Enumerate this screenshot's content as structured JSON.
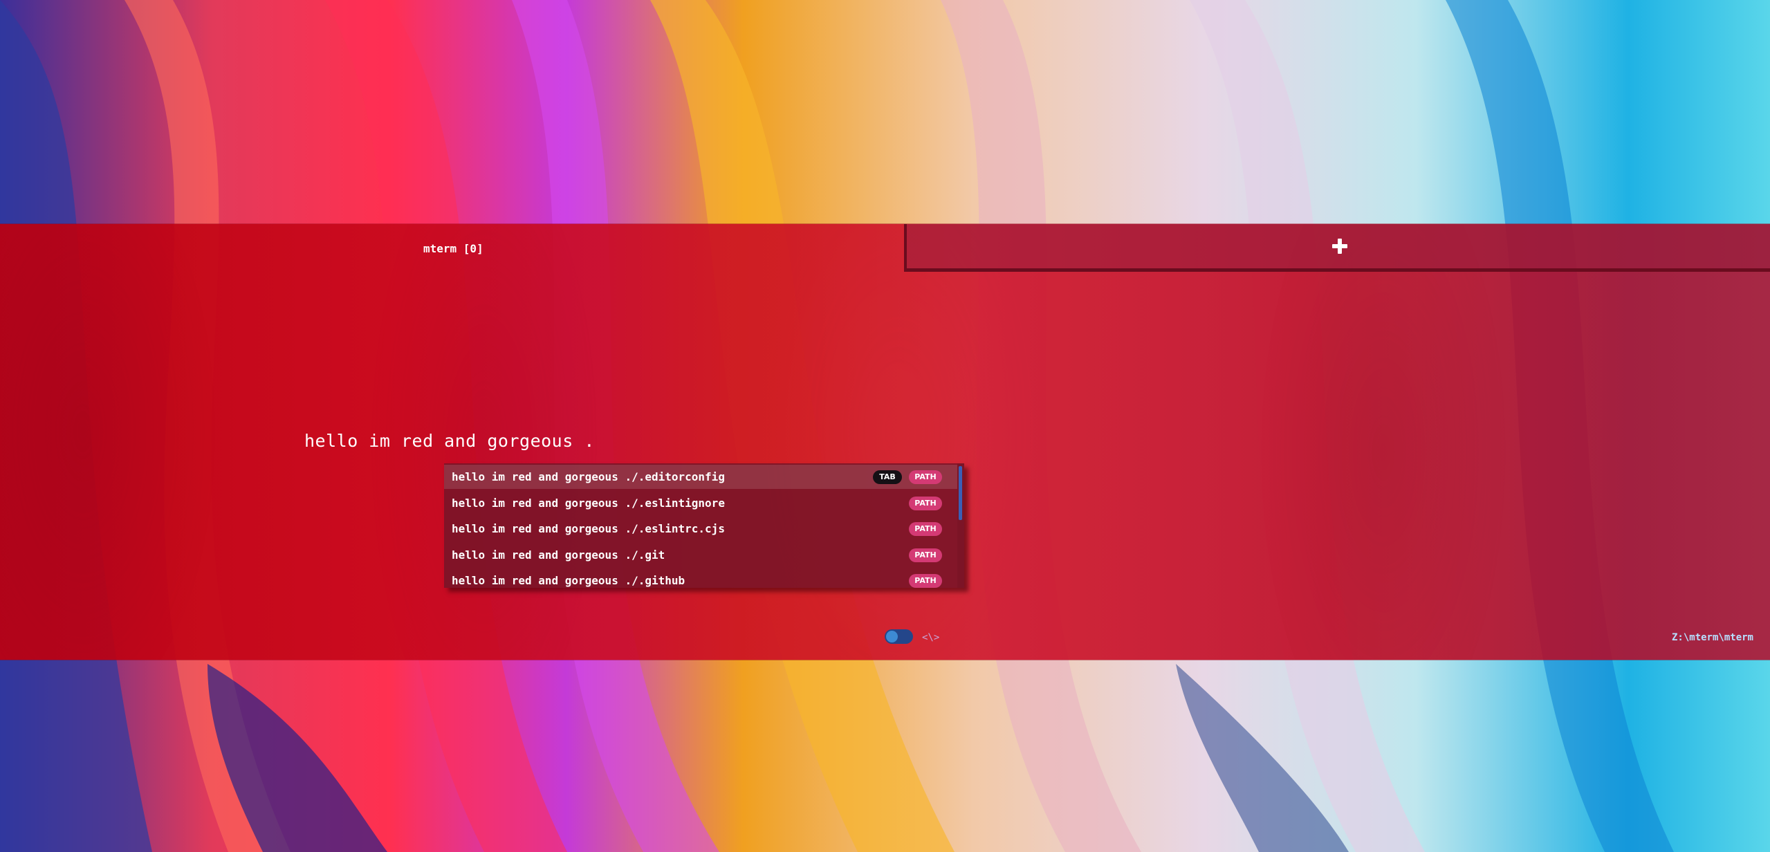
{
  "tab": {
    "title": "mterm [0]",
    "new_tab_icon": "plus-icon"
  },
  "terminal": {
    "prompt_text": "hello im red and gorgeous ."
  },
  "suggestions": [
    {
      "text": "hello im red and gorgeous ./.editorconfig",
      "key_hint": "TAB",
      "type": "PATH",
      "active": true
    },
    {
      "text": "hello im red and gorgeous ./.eslintignore",
      "type": "PATH"
    },
    {
      "text": "hello im red and gorgeous ./.eslintrc.cjs",
      "type": "PATH"
    },
    {
      "text": "hello im red and gorgeous ./.git",
      "type": "PATH"
    },
    {
      "text": "hello im red and gorgeous ./.github",
      "type": "PATH"
    }
  ],
  "status": {
    "toggle_on": true,
    "code_icon": "<\\>",
    "cwd": "Z:\\mterm\\mterm"
  },
  "colors": {
    "band": "#c8102e",
    "badge_path": "#d43a74",
    "badge_tab": "#151015",
    "toggle": "#24468a"
  }
}
